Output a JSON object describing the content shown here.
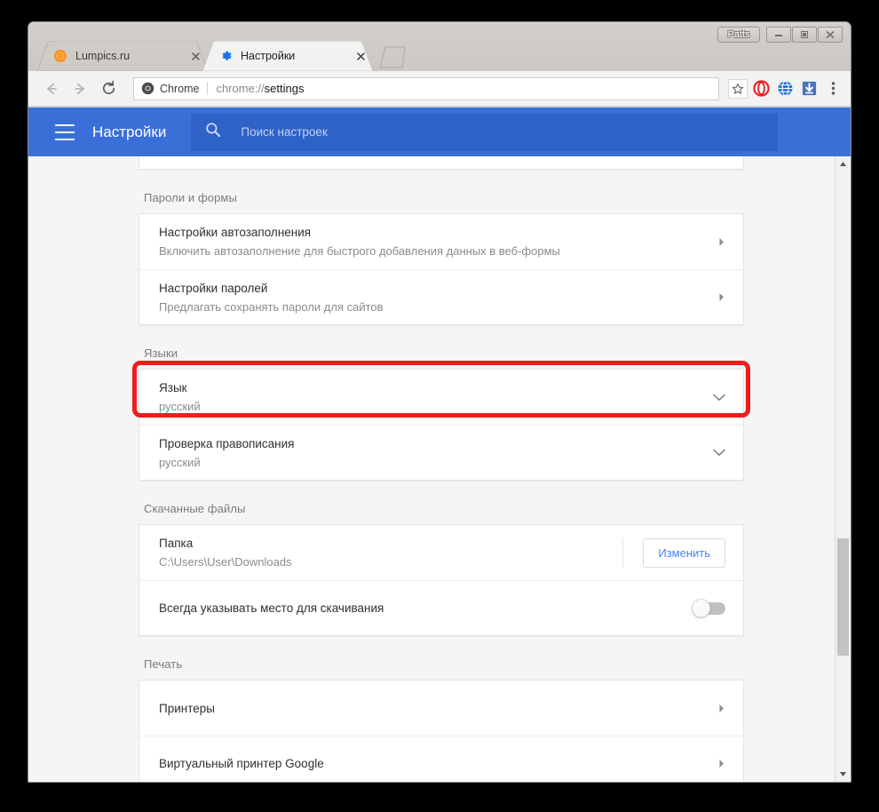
{
  "window": {
    "profile_label": "Patts",
    "controls": {
      "minimize": "minimize-icon",
      "maximize": "maximize-icon",
      "close": "close-icon"
    }
  },
  "tabs": [
    {
      "title": "Lumpics.ru",
      "favicon": "orange-citrus-icon",
      "active": false,
      "close": "close-icon"
    },
    {
      "title": "Настройки",
      "favicon": "blue-gear-icon",
      "active": true,
      "close": "close-icon"
    }
  ],
  "new_tab": {
    "name": "new-tab-button"
  },
  "toolbar": {
    "back": "back-arrow-icon",
    "forward": "forward-arrow-icon",
    "reload": "reload-icon",
    "security_label": "Chrome",
    "url_scheme": "chrome://",
    "url_path": "settings",
    "bookmark": "star-icon",
    "extension_opera": "opera-extension-icon",
    "extension_globe": "globe-extension-icon",
    "extension_download": "download-extension-icon",
    "menu": "three-dot-menu-icon"
  },
  "settings_header": {
    "menu_icon": "hamburger-menu-icon",
    "title": "Настройки",
    "search_icon": "search-icon",
    "search_placeholder": "Поиск настроек",
    "search_value": ""
  },
  "sections": [
    {
      "title": "Пароли и формы",
      "rows": [
        {
          "title": "Настройки автозаполнения",
          "sub": "Включить автозаполнение для быстрого добавления данных в веб-формы",
          "control": "arrow"
        },
        {
          "title": "Настройки паролей",
          "sub": "Предлагать сохранять пароли для сайтов",
          "control": "arrow"
        }
      ]
    },
    {
      "title": "Языки",
      "rows": [
        {
          "title": "Язык",
          "sub": "русский",
          "control": "chevron",
          "highlighted": true
        },
        {
          "title": "Проверка правописания",
          "sub": "русский",
          "control": "chevron"
        }
      ]
    },
    {
      "title": "Скачанные файлы",
      "rows": [
        {
          "title": "Папка",
          "sub": "C:\\Users\\User\\Downloads",
          "control": "button",
          "button_label": "Изменить"
        },
        {
          "title": "Всегда указывать место для скачивания",
          "sub": "",
          "control": "toggle",
          "toggle_on": false
        }
      ]
    },
    {
      "title": "Печать",
      "rows": [
        {
          "title": "Принтеры",
          "sub": "",
          "control": "arrow"
        },
        {
          "title": "Виртуальный принтер Google",
          "sub": "",
          "control": "arrow"
        }
      ]
    }
  ],
  "scrollbar": {
    "up_arrow": "scroll-up-icon",
    "down_arrow": "scroll-down-icon"
  },
  "colors": {
    "header_blue": "#3a6fd8",
    "search_blue": "#2f62c7",
    "accent_link": "#4285f4",
    "highlight_red": "#ee1d1d",
    "page_bg": "#f5f5f5"
  }
}
